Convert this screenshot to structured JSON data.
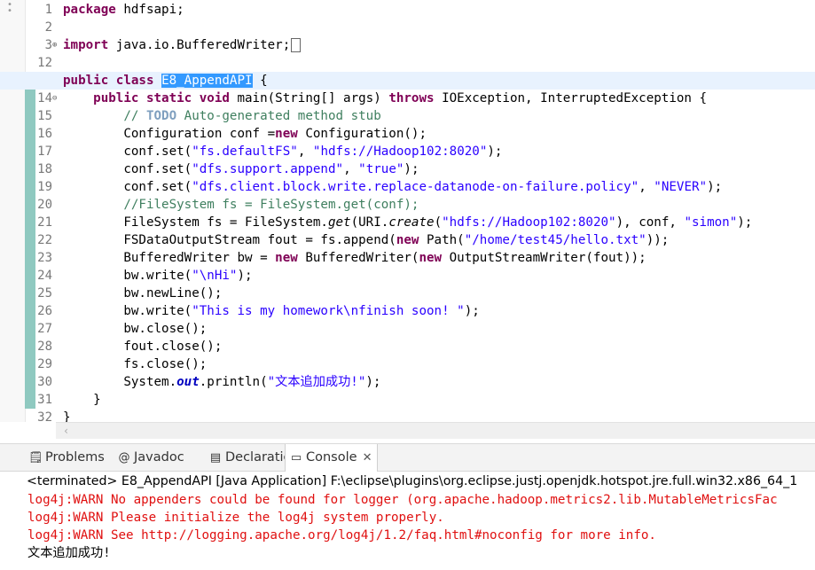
{
  "editor": {
    "lines": [
      {
        "n": "1",
        "html": "<span class='kw'>package</span> hdfsapi;"
      },
      {
        "n": "2",
        "html": ""
      },
      {
        "n": "3",
        "html": "<span class='kw'>import</span> java.io.BufferedWriter;<span class='collapsed-box'></span>",
        "fold": "⊕"
      },
      {
        "n": "12",
        "html": ""
      },
      {
        "n": "13",
        "html": "<span class='kw'>public</span> <span class='kw'>class</span> <span class='sel'>E8_AppendAPI</span> {",
        "highlight": true
      },
      {
        "n": "14",
        "html": "    <span class='kw'>public</span> <span class='kw'>static</span> <span class='kw'>void</span> main(String[] args) <span class='kw'>throws</span> IOException, InterruptedException {",
        "fold": "⊖"
      },
      {
        "n": "15",
        "html": "        <span class='cmt'>// </span><span class='todo'>TODO</span><span class='cmt'> Auto-generated method stub</span>"
      },
      {
        "n": "16",
        "html": "        Configuration conf =<span class='kw'>new</span> Configuration();"
      },
      {
        "n": "17",
        "html": "        conf.set(<span class='str'>\"fs.defaultFS\"</span>, <span class='str'>\"hdfs://Hadoop102:8020\"</span>);"
      },
      {
        "n": "18",
        "html": "        conf.set(<span class='str'>\"dfs.support.append\"</span>, <span class='str'>\"true\"</span>);"
      },
      {
        "n": "19",
        "html": "        conf.set(<span class='str'>\"dfs.client.block.write.replace-datanode-on-failure.policy\"</span>, <span class='str'>\"NEVER\"</span>);"
      },
      {
        "n": "20",
        "html": "        <span class='cmt'>//FileSystem fs = FileSystem.get(conf);</span>"
      },
      {
        "n": "21",
        "html": "        FileSystem fs = FileSystem.<span class='it'>get</span>(URI.<span class='it'>create</span>(<span class='str'>\"hdfs://Hadoop102:8020\"</span>), conf, <span class='str'>\"simon\"</span>);"
      },
      {
        "n": "22",
        "html": "        FSDataOutputStream fout = fs.append(<span class='kw'>new</span> Path(<span class='str'>\"/home/test45/hello.txt\"</span>));"
      },
      {
        "n": "23",
        "html": "        BufferedWriter bw = <span class='kw'>new</span> BufferedWriter(<span class='kw'>new</span> OutputStreamWriter(fout));"
      },
      {
        "n": "24",
        "html": "        bw.write(<span class='str'>\"\\nHi\"</span>);"
      },
      {
        "n": "25",
        "html": "        bw.newLine();"
      },
      {
        "n": "26",
        "html": "        bw.write(<span class='str'>\"This is my homework\\nfinish soon! \"</span>);"
      },
      {
        "n": "27",
        "html": "        bw.close();"
      },
      {
        "n": "28",
        "html": "        fout.close();"
      },
      {
        "n": "29",
        "html": "        fs.close();"
      },
      {
        "n": "30",
        "html": "        System.<span class='sfld'>out</span>.println(<span class='str'>\"文本追加成功!\"</span>);"
      },
      {
        "n": "31",
        "html": "    }"
      },
      {
        "n": "32",
        "html": "}"
      }
    ]
  },
  "views": {
    "tabs": [
      {
        "label": "Problems",
        "icon": "🗒",
        "icon_name": "problems-icon"
      },
      {
        "label": "Javadoc",
        "icon": "@",
        "icon_name": "javadoc-icon"
      },
      {
        "label": "Declaration",
        "icon": "▤",
        "icon_name": "declaration-icon"
      },
      {
        "label": "Console",
        "icon": "▭",
        "icon_name": "console-icon",
        "active": true
      }
    ],
    "close_symbol": "✕",
    "console": {
      "header": "<terminated> E8_AppendAPI [Java Application] F:\\eclipse\\plugins\\org.eclipse.justj.openjdk.hotspot.jre.full.win32.x86_64_1",
      "lines": [
        {
          "text": "log4j:WARN No appenders could be found for logger (org.apache.hadoop.metrics2.lib.MutableMetricsFac",
          "kind": "warn"
        },
        {
          "text": "log4j:WARN Please initialize the log4j system properly.",
          "kind": "warn"
        },
        {
          "text": "log4j:WARN See http://logging.apache.org/log4j/1.2/faq.html#noconfig for more info.",
          "kind": "warn"
        },
        {
          "text": "文本追加成功!",
          "kind": "out"
        }
      ]
    }
  },
  "colors": {
    "keyword": "#7f0055",
    "string": "#2a00ff",
    "comment": "#3f7f5f",
    "warn": "#e01010",
    "selection": "#3399ff",
    "quickdiff": "#8fc9c0"
  }
}
